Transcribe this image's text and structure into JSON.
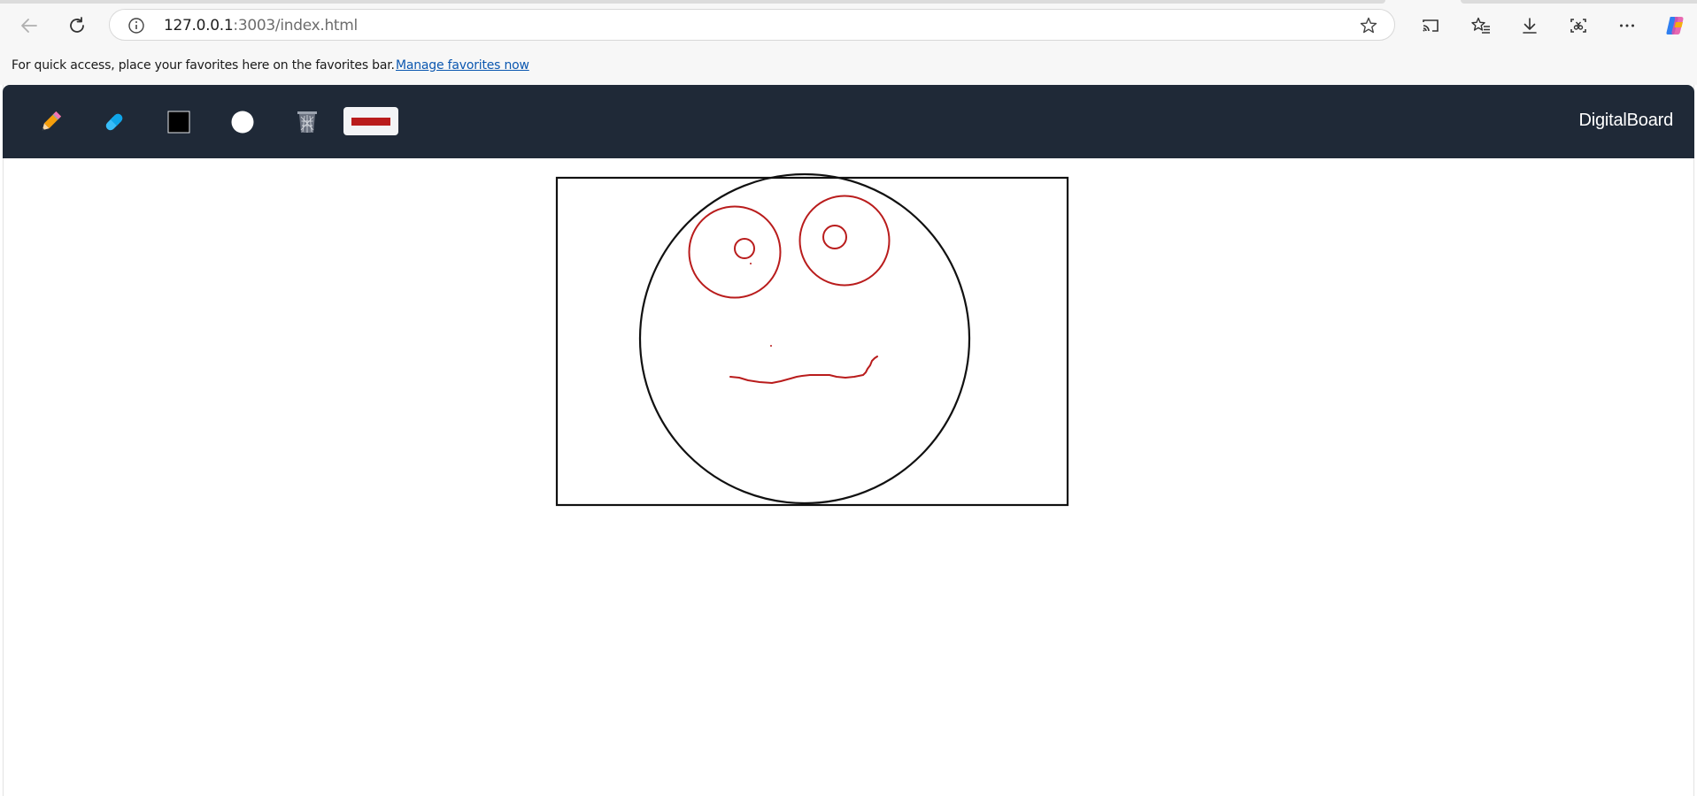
{
  "browser": {
    "url_host": "127.0.0.1",
    "url_rest": ":3003/index.html"
  },
  "favorites_bar": {
    "message": "For quick access, place your favorites here on the favorites bar.",
    "link": "Manage favorites now"
  },
  "app": {
    "brand": "DigitalBoard",
    "tools": [
      "pencil-icon",
      "eraser-icon",
      "square-icon",
      "circle-icon",
      "trash-icon",
      "brush-size"
    ],
    "colors": {
      "header_bg": "#1f2937",
      "stroke_black": "#111111",
      "stroke_red": "#b91c1c"
    }
  }
}
